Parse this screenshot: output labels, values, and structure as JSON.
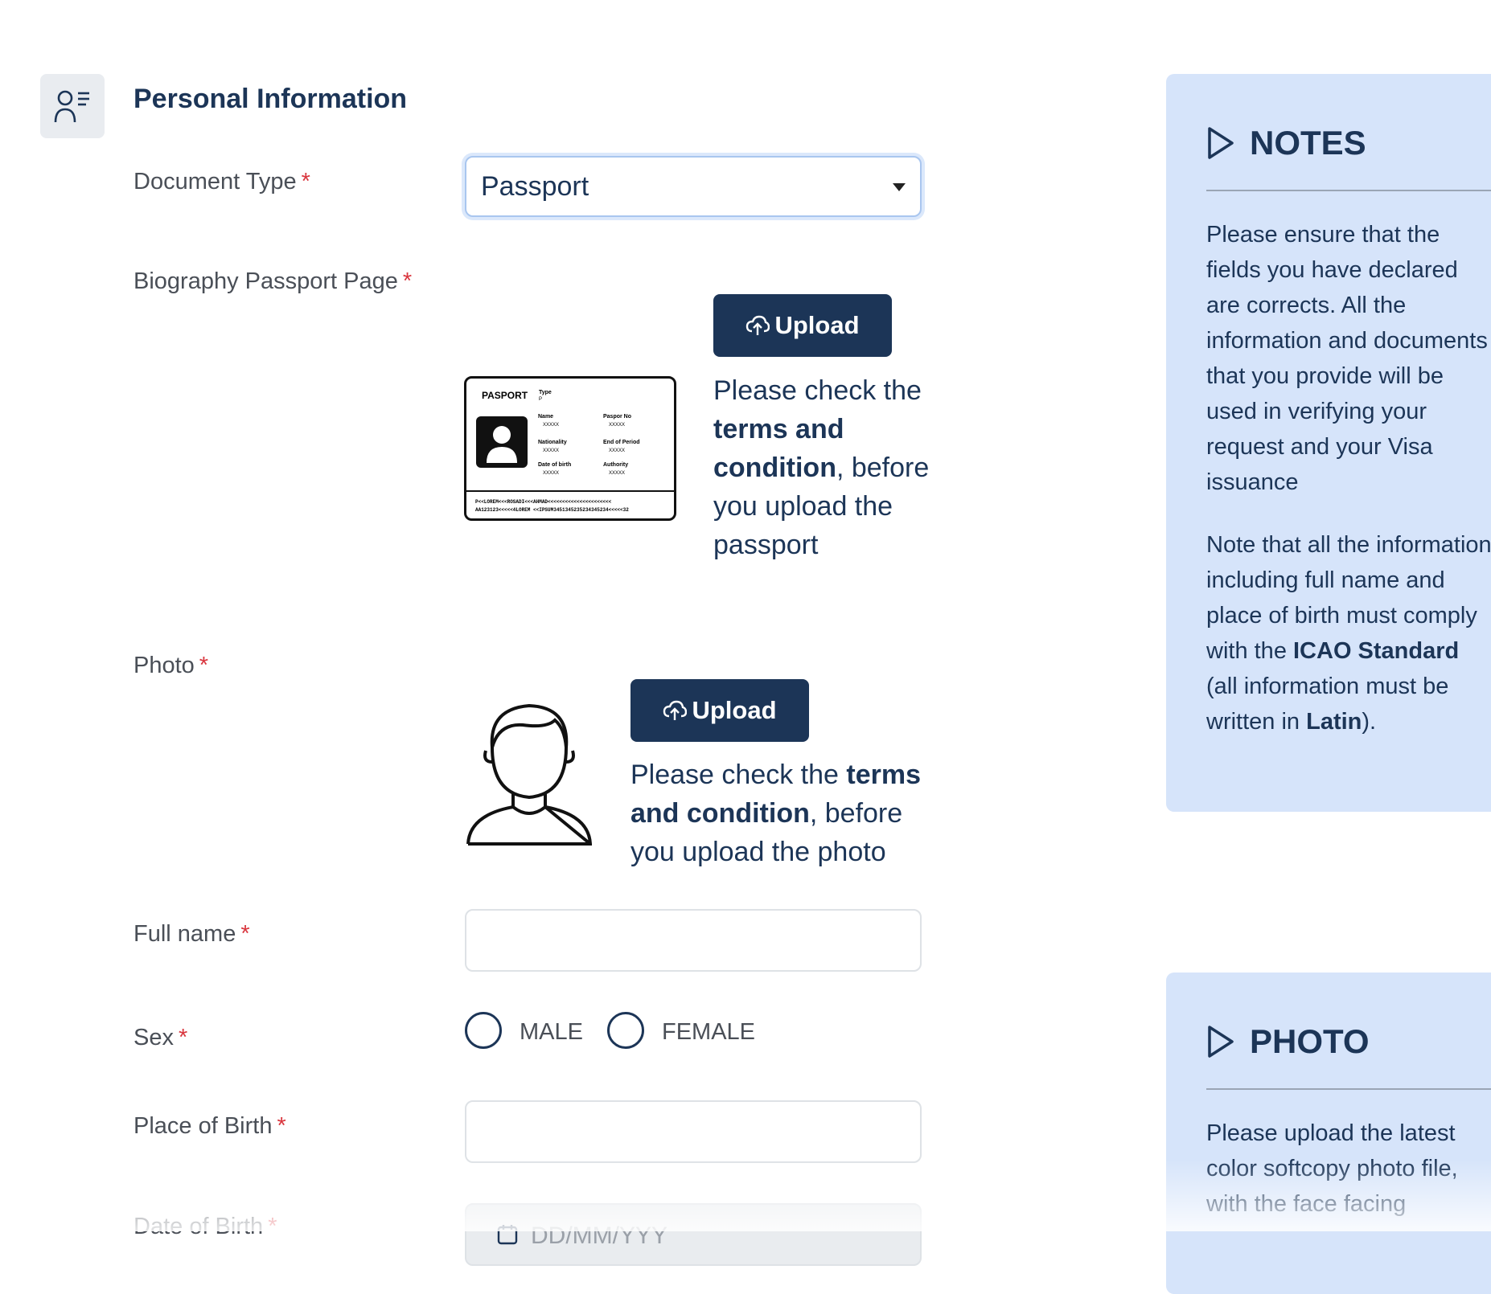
{
  "section": {
    "title": "Personal Information",
    "icon": "user-list-icon"
  },
  "document_type": {
    "label": "Document Type",
    "required": "*",
    "value": "Passport"
  },
  "biography": {
    "label": "Biography Passport Page",
    "required": "*",
    "upload_label": "Upload",
    "hint_1": "Please check the",
    "hint_bold": "terms and condition",
    "hint_2": ", before you upload the passport",
    "card": {
      "title": "PASPORT",
      "type_label": "Type",
      "type_value": "P",
      "name_label": "Name",
      "name_value": "XXXXX",
      "paspor_no_label": "Paspor No",
      "paspor_no_value": "XXXXX",
      "nationality_label": "Nationality",
      "nationality_value": "XXXXX",
      "end_label": "End of Period",
      "end_value": "XXXXX",
      "dob_label": "Date of birth",
      "dob_value": "XXXXX",
      "authority_label": "Authority",
      "authority_value": "XXXXX",
      "mrz_1": "P<<LOREM<<<ROSADI<<<AHMAD<<<<<<<<<<<<<<<<<<<<<<",
      "mrz_2": "AA123123<<<<<4LOREM <<IPSUM3451345235234345234<<<<<32"
    }
  },
  "photo": {
    "label": "Photo",
    "required": "*",
    "upload_label": "Upload",
    "hint_1": "Please check the ",
    "hint_bold": "terms and condition",
    "hint_2": ", before you upload the photo"
  },
  "full_name": {
    "label": "Full name",
    "required": "*",
    "value": ""
  },
  "sex": {
    "label": "Sex",
    "required": "*",
    "options": [
      "MALE",
      "FEMALE"
    ]
  },
  "place_of_birth": {
    "label": "Place of Birth",
    "required": "*",
    "value": ""
  },
  "date_of_birth": {
    "label": "Date of Birth",
    "required": "*",
    "placeholder": "DD/MM/YYY"
  },
  "notes_panel": {
    "title": "NOTES",
    "para_1": "Please ensure that the fields you have declared are corrects. All the information and documents that you provide will be used in verifying your request and your Visa issuance",
    "para_2_a": "Note that all the information including full name and place of birth must comply with the ",
    "para_2_bold_1": "ICAO Standard",
    "para_2_b": " (all information must be written in ",
    "para_2_bold_2": "Latin",
    "para_2_c": ")."
  },
  "photo_panel": {
    "title": "PHOTO",
    "text": "Please upload the latest color softcopy photo file, with the face facing"
  },
  "colors": {
    "navy": "#1c3557",
    "panel": "#d6e4fa",
    "required": "#d9363e"
  }
}
